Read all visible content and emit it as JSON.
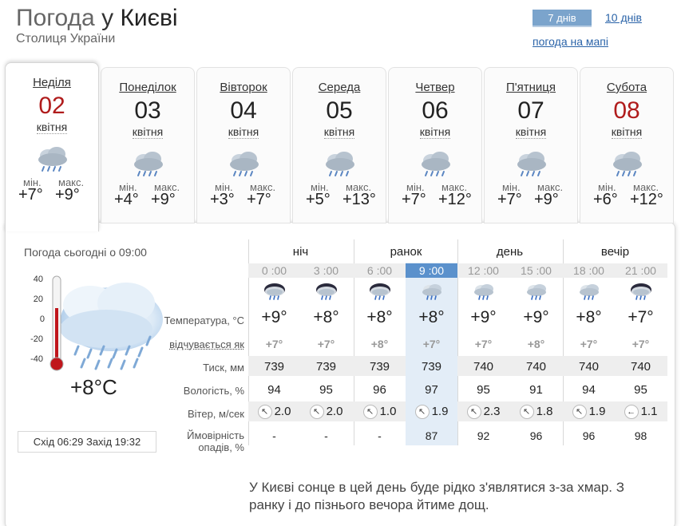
{
  "header": {
    "title_prefix": "Погода",
    "title_mid": "у",
    "title_city": "Києві",
    "subtitle": "Столиця України",
    "btn_7days": "7 днів",
    "link_10days": "10 днів",
    "link_map": "погода на мапі"
  },
  "days": [
    {
      "name": "Неділя",
      "num": "02",
      "month": "квітня",
      "min_label": "мін.",
      "max_label": "макс.",
      "tmin": "+7°",
      "tmax": "+9°",
      "weekend": true,
      "active": true
    },
    {
      "name": "Понеділок",
      "num": "03",
      "month": "квітня",
      "min_label": "мін.",
      "max_label": "макс.",
      "tmin": "+4°",
      "tmax": "+9°",
      "weekend": false,
      "active": false
    },
    {
      "name": "Вівторок",
      "num": "04",
      "month": "квітня",
      "min_label": "мін.",
      "max_label": "макс.",
      "tmin": "+3°",
      "tmax": "+7°",
      "weekend": false,
      "active": false
    },
    {
      "name": "Середа",
      "num": "05",
      "month": "квітня",
      "min_label": "мін.",
      "max_label": "макс.",
      "tmin": "+5°",
      "tmax": "+13°",
      "weekend": false,
      "active": false
    },
    {
      "name": "Четвер",
      "num": "06",
      "month": "квітня",
      "min_label": "мін.",
      "max_label": "макс.",
      "tmin": "+7°",
      "tmax": "+12°",
      "weekend": false,
      "active": false
    },
    {
      "name": "П'ятниця",
      "num": "07",
      "month": "квітня",
      "min_label": "мін.",
      "max_label": "макс.",
      "tmin": "+7°",
      "tmax": "+9°",
      "weekend": false,
      "active": false
    },
    {
      "name": "Субота",
      "num": "08",
      "month": "квітня",
      "min_label": "мін.",
      "max_label": "макс.",
      "tmin": "+6°",
      "tmax": "+12°",
      "weekend": true,
      "active": false
    }
  ],
  "now": {
    "label": "Погода сьогодні о 09:00",
    "temp": "+8°C",
    "scale": [
      "40",
      "20",
      "0",
      "-20",
      "-40"
    ],
    "sunrise_label": "Схід",
    "sunrise": "06:29",
    "sunset_label": "Захід",
    "sunset": "19:32"
  },
  "periods": [
    "ніч",
    "ранок",
    "день",
    "вечір"
  ],
  "row_labels": {
    "temp": "Температура, °C",
    "feels": "відчувається як",
    "pressure": "Тиск, мм",
    "humidity": "Вологість, %",
    "wind": "Вітер, м/сек",
    "precip_1": "Ймовірність",
    "precip_2": "опадів, %"
  },
  "hours": [
    {
      "time": "0 :00",
      "temp": "+9°",
      "feels": "+7°",
      "pressure": "739",
      "humidity": "94",
      "wind": "2.0",
      "wind_dir": "↖",
      "precip": "-",
      "icon": "night-rain-icon"
    },
    {
      "time": "3 :00",
      "temp": "+8°",
      "feels": "+7°",
      "pressure": "739",
      "humidity": "95",
      "wind": "2.0",
      "wind_dir": "↖",
      "precip": "-",
      "icon": "night-rain-icon"
    },
    {
      "time": "6 :00",
      "temp": "+8°",
      "feels": "+8°",
      "pressure": "739",
      "humidity": "96",
      "wind": "1.0",
      "wind_dir": "↖",
      "precip": "-",
      "icon": "night-rain-icon"
    },
    {
      "time": "9 :00",
      "temp": "+8°",
      "feels": "+7°",
      "pressure": "739",
      "humidity": "97",
      "wind": "1.9",
      "wind_dir": "↖",
      "precip": "87",
      "icon": "cloud-rain-icon"
    },
    {
      "time": "12 :00",
      "temp": "+9°",
      "feels": "+7°",
      "pressure": "740",
      "humidity": "95",
      "wind": "2.3",
      "wind_dir": "↖",
      "precip": "92",
      "icon": "cloud-rain-icon"
    },
    {
      "time": "15 :00",
      "temp": "+9°",
      "feels": "+8°",
      "pressure": "740",
      "humidity": "91",
      "wind": "1.8",
      "wind_dir": "↖",
      "precip": "96",
      "icon": "cloud-rain-icon"
    },
    {
      "time": "18 :00",
      "temp": "+8°",
      "feels": "+7°",
      "pressure": "740",
      "humidity": "94",
      "wind": "1.9",
      "wind_dir": "↖",
      "precip": "96",
      "icon": "cloud-rain-icon"
    },
    {
      "time": "21 :00",
      "temp": "+7°",
      "feels": "+7°",
      "pressure": "740",
      "humidity": "95",
      "wind": "1.1",
      "wind_dir": "←",
      "precip": "98",
      "icon": "night-rain-icon"
    }
  ],
  "description": "У Києві сонце в цей день буде рідко з'являтися з-за хмар. З ранку і до пізнього вечора йтиме дощ.",
  "colors": {
    "accent": "#5b91cc",
    "weekend": "#b01c1c",
    "link": "#2a63a8",
    "highlight": "#e3edf7"
  }
}
